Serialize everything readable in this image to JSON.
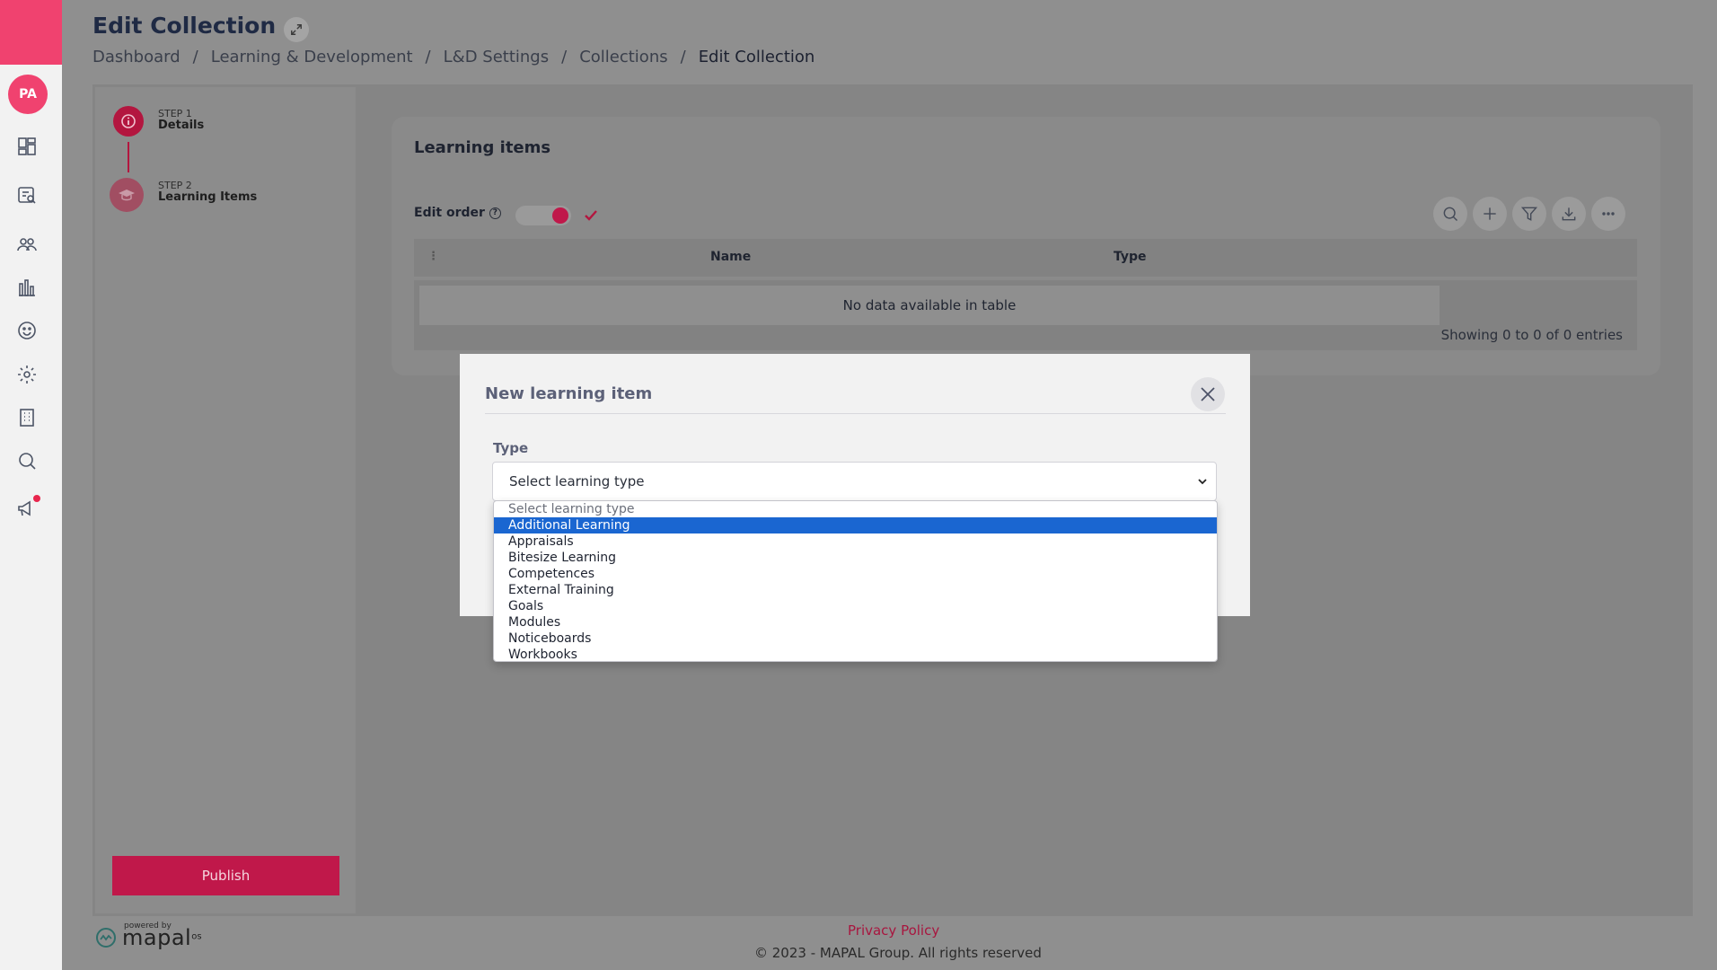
{
  "user": {
    "initials": "PA"
  },
  "page": {
    "title": "Edit Collection",
    "breadcrumb": [
      "Dashboard",
      "Learning & Development",
      "L&D Settings",
      "Collections",
      "Edit Collection"
    ]
  },
  "steps": [
    {
      "step_label": "STEP 1",
      "name": "Details"
    },
    {
      "step_label": "STEP 2",
      "name": "Learning Items"
    }
  ],
  "publish_label": "Publish",
  "card": {
    "title": "Learning items",
    "edit_order_label": "Edit order",
    "help_glyph": "?",
    "columns": {
      "drag": "⋮",
      "name": "Name",
      "type": "Type"
    },
    "empty_text": "No data available in table",
    "entries_info": "Showing 0 to 0 of 0 entries"
  },
  "modal": {
    "title": "New learning item",
    "type_label": "Type",
    "select_value": "Select learning type",
    "options": [
      "Select learning type",
      "Additional Learning",
      "Appraisals",
      "Bitesize Learning",
      "Competences",
      "External Training",
      "Goals",
      "Modules",
      "Noticeboards",
      "Workbooks"
    ],
    "highlighted_index": 1
  },
  "footer": {
    "powered_by": "powered by",
    "brand": "mapal",
    "brand_suffix": "os",
    "privacy": "Privacy Policy",
    "copyright": "© 2023 - MAPAL Group. All rights reserved"
  },
  "colors": {
    "brand_pink": "#f0426f",
    "primary": "#c0184a",
    "highlight": "#1a66d1"
  }
}
